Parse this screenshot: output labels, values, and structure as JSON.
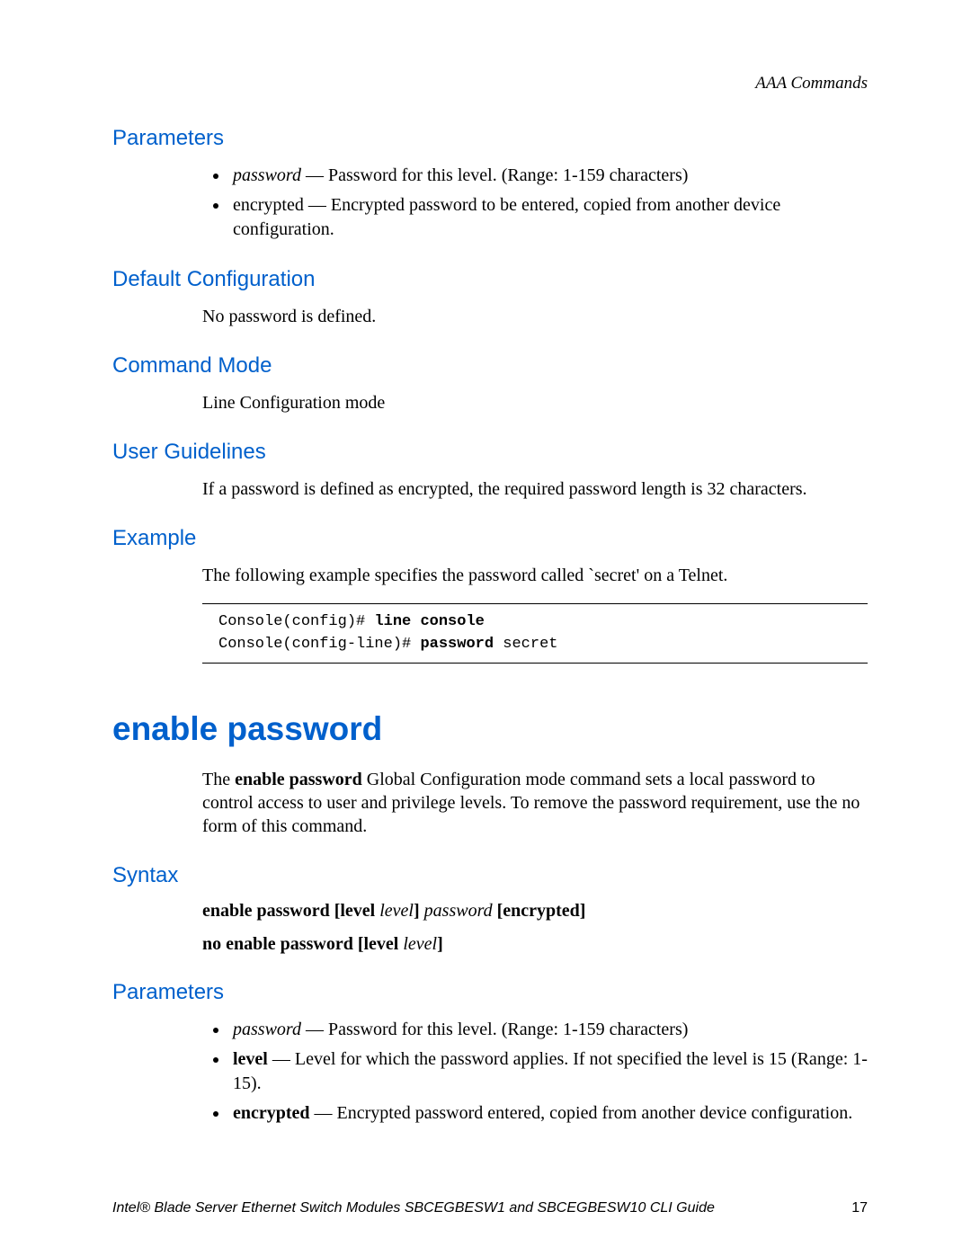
{
  "header": {
    "chapter": "AAA Commands"
  },
  "sec1": {
    "h_parameters": "Parameters",
    "param1_name": "password",
    "param1_desc": " — Password for this level. (Range: 1-159 characters)",
    "param2_name": "encrypted",
    "param2_desc": " — Encrypted password to be entered, copied from another device configuration.",
    "h_default": "Default Configuration",
    "default_body": "No password is defined.",
    "h_mode": "Command Mode",
    "mode_body": "Line Configuration mode",
    "h_guidelines": "User Guidelines",
    "guidelines_body": "If a password is defined as encrypted, the required password length is 32 characters.",
    "h_example": "Example",
    "example_intro": "The following example specifies the password called `secret' on a Telnet.",
    "code_l1_pre": "Console(config)# ",
    "code_l1_cmd": "line console",
    "code_l2_pre": "Console(config-line)# ",
    "code_l2_cmd": "password",
    "code_l2_arg": " secret"
  },
  "sec2": {
    "title": "enable password",
    "intro_pre": "The ",
    "intro_cmd": "enable password",
    "intro_post": " Global Configuration mode command sets a local password to control access to user and privilege levels. To remove the password requirement, use the no form of this command.",
    "h_syntax": "Syntax",
    "syntax1_b1": "enable password ",
    "syntax1_b2": "[level ",
    "syntax1_i1": "level",
    "syntax1_b3": "] ",
    "syntax1_i2": "password ",
    "syntax1_b4": "[encrypted]",
    "syntax2_b1": "no enable password ",
    "syntax2_b2": "[level ",
    "syntax2_i1": "level",
    "syntax2_b3": "]",
    "h_parameters": "Parameters",
    "p1_name": "password",
    "p1_desc": " — Password for this level. (Range: 1-159 characters)",
    "p2_name": "level",
    "p2_desc": " — Level for which the password applies. If not specified the level is 15 (Range: 1-15).",
    "p3_name": "encrypted",
    "p3_desc": " — Encrypted password entered, copied from another device configuration."
  },
  "footer": {
    "title": "Intel® Blade Server Ethernet Switch Modules SBCEGBESW1 and SBCEGBESW10 CLI Guide",
    "page": "17"
  }
}
